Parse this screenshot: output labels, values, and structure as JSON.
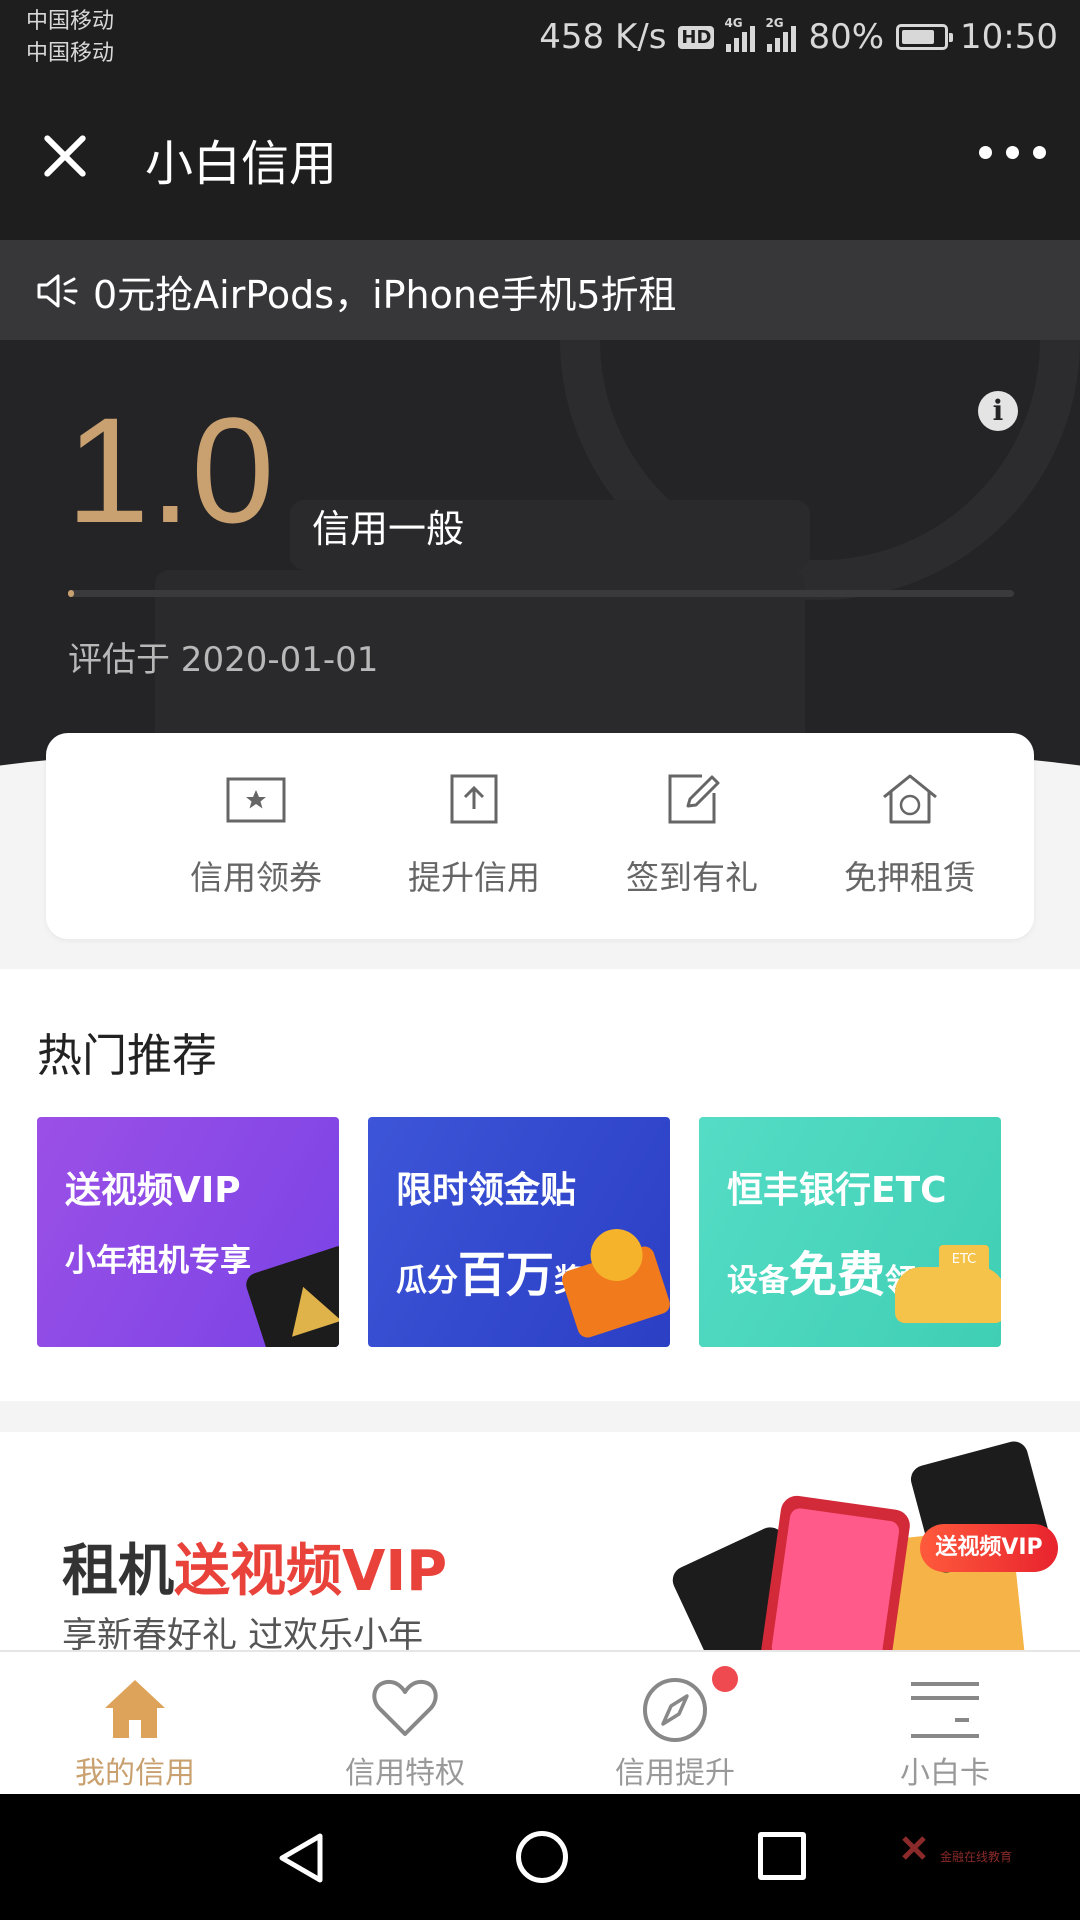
{
  "status_bar": {
    "carrier_1": "中国移动",
    "carrier_2": "中国移动",
    "speed": "458 K/s",
    "hd": "HD",
    "net_1": "4G",
    "net_2": "2G",
    "battery": "80%",
    "battery_level": 0.8,
    "time": "10:50"
  },
  "header": {
    "title": "小白信用"
  },
  "notice": {
    "text": "0元抢AirPods，iPhone手机5折租"
  },
  "credit": {
    "score": "1.0",
    "level": "信用一般",
    "progress": 0.005,
    "evaluated": "评估于 2020-01-01",
    "info_glyph": "i"
  },
  "quick_actions": [
    {
      "label": "信用领券",
      "icon": "coupon-icon"
    },
    {
      "label": "提升信用",
      "icon": "upload-icon"
    },
    {
      "label": "签到有礼",
      "icon": "edit-icon"
    },
    {
      "label": "免押租赁",
      "icon": "house-icon"
    }
  ],
  "hot": {
    "title": "热门推荐",
    "promos": [
      {
        "line1": "送视频VIP",
        "line2": "小年租机专享"
      },
      {
        "line1": "限时领金贴",
        "line2_pre": "瓜分",
        "line2_big": "百万",
        "line2_post": "奖池"
      },
      {
        "line1": "恒丰银行ETC",
        "line2_pre": "设备",
        "line2_big": "免费",
        "line2_post": "领",
        "tag": "ETC"
      }
    ]
  },
  "banner": {
    "title_1": "租机",
    "title_2": "送视频VIP",
    "subtitle": "享新春好礼 过欢乐小年",
    "pill": "送视频VIP"
  },
  "bottom_nav": [
    {
      "label": "我的信用",
      "active": true
    },
    {
      "label": "信用特权",
      "active": false
    },
    {
      "label": "信用提升",
      "active": false,
      "badge": true
    },
    {
      "label": "小白卡",
      "active": false
    }
  ],
  "watermark": {
    "text": "金融在线教育"
  },
  "colors": {
    "accent": "#c9a170",
    "dark_bg": "#242426",
    "banner_red": "#e8423a",
    "badge_red": "#ee4a50"
  }
}
